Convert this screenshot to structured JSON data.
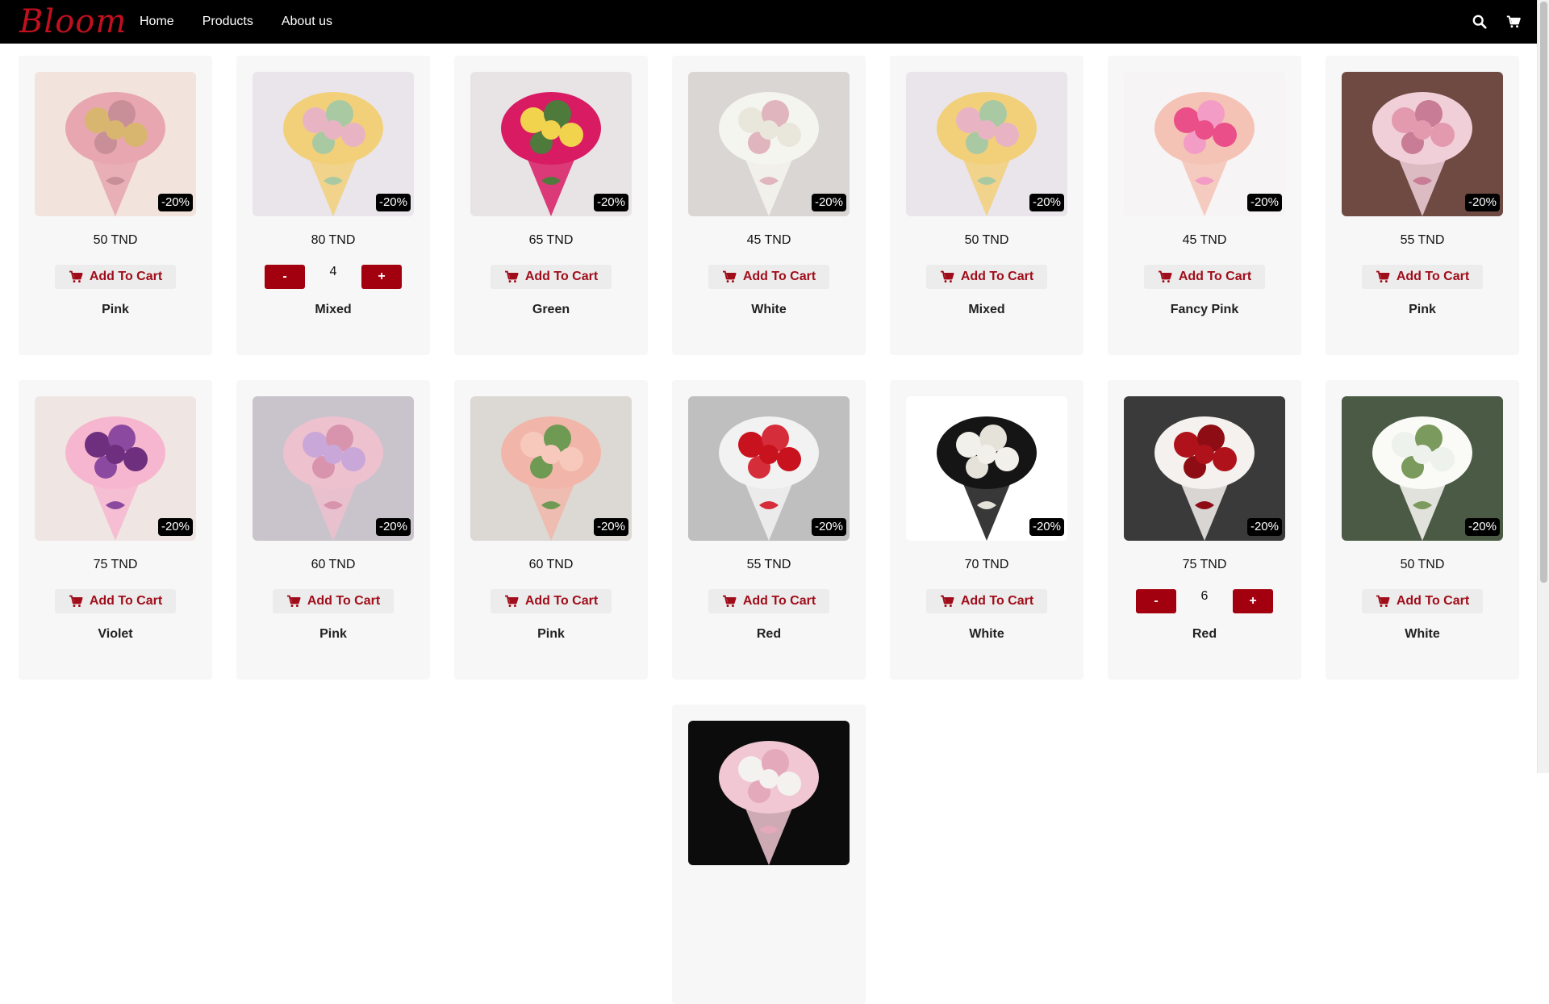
{
  "nav": {
    "logo": "Bloom",
    "links": [
      "Home",
      "Products",
      "About us"
    ],
    "icons": [
      "search-icon",
      "cart-icon"
    ]
  },
  "add_label": "Add To Cart",
  "step_minus": "-",
  "step_plus": "+",
  "products": [
    {
      "price": "50 TND",
      "color": "Pink",
      "discount": "-20%",
      "qty": null,
      "palette": [
        "#f2e3dc",
        "#e8a6b0",
        "#d8b66f",
        "#c98f98"
      ]
    },
    {
      "price": "80 TND",
      "color": "Mixed",
      "discount": "-20%",
      "qty": "4",
      "palette": [
        "#e9e5ea",
        "#f2d07a",
        "#e8b4c4",
        "#a9c9a3"
      ]
    },
    {
      "price": "65 TND",
      "color": "Green",
      "discount": "-20%",
      "qty": null,
      "palette": [
        "#e8e4e6",
        "#d81b63",
        "#f1d34d",
        "#4e7a3b"
      ]
    },
    {
      "price": "45 TND",
      "color": "White",
      "discount": "-20%",
      "qty": null,
      "palette": [
        "#d9d6d3",
        "#f5f5ef",
        "#e9e6dc",
        "#e0b5be"
      ]
    },
    {
      "price": "50 TND",
      "color": "Mixed",
      "discount": "-20%",
      "qty": null,
      "palette": [
        "#e9e5ea",
        "#f2d07a",
        "#e8b4c4",
        "#a9c9a3"
      ]
    },
    {
      "price": "45 TND",
      "color": "Fancy Pink",
      "discount": "-20%",
      "qty": null,
      "palette": [
        "#f6f4f5",
        "#f5c3b5",
        "#ea4f8a",
        "#f39cc6"
      ]
    },
    {
      "price": "55 TND",
      "color": "Pink",
      "discount": "-20%",
      "qty": null,
      "palette": [
        "#6e4a43",
        "#f0cfd8",
        "#e39aae",
        "#c87c95"
      ]
    },
    {
      "price": "75 TND",
      "color": "Violet",
      "discount": "-20%",
      "qty": null,
      "palette": [
        "#efe6e3",
        "#f7b6cf",
        "#6e2f7e",
        "#8b4aa0"
      ]
    },
    {
      "price": "60 TND",
      "color": "Pink",
      "discount": "-20%",
      "qty": null,
      "palette": [
        "#c9c4cb",
        "#eec1cf",
        "#c9a7d8",
        "#d893ad"
      ]
    },
    {
      "price": "60 TND",
      "color": "Pink",
      "discount": "-20%",
      "qty": null,
      "palette": [
        "#dcd9d4",
        "#f1b6a9",
        "#f7c9bd",
        "#6f9a54"
      ]
    },
    {
      "price": "55 TND",
      "color": "Red",
      "discount": "-20%",
      "qty": null,
      "palette": [
        "#bfbfbf",
        "#f2f2f2",
        "#c8121e",
        "#d62d3a"
      ]
    },
    {
      "price": "70 TND",
      "color": "White",
      "discount": "-20%",
      "qty": null,
      "palette": [
        "#ffffff",
        "#151515",
        "#f2f0ea",
        "#e5e2da"
      ]
    },
    {
      "price": "75 TND",
      "color": "Red",
      "discount": "-20%",
      "qty": "6",
      "palette": [
        "#3a3a3a",
        "#f4f1ee",
        "#b0121b",
        "#8e0d15"
      ]
    },
    {
      "price": "50 TND",
      "color": "White",
      "discount": "-20%",
      "qty": null,
      "palette": [
        "#4a5a44",
        "#fafaf6",
        "#eef2ec",
        "#7b9a5d"
      ]
    },
    {
      "price": "",
      "color": "",
      "discount": "",
      "qty": null,
      "palette": [
        "#0c0c0c",
        "#f0c7d2",
        "#f4f2ee",
        "#e4a9bb"
      ]
    }
  ]
}
